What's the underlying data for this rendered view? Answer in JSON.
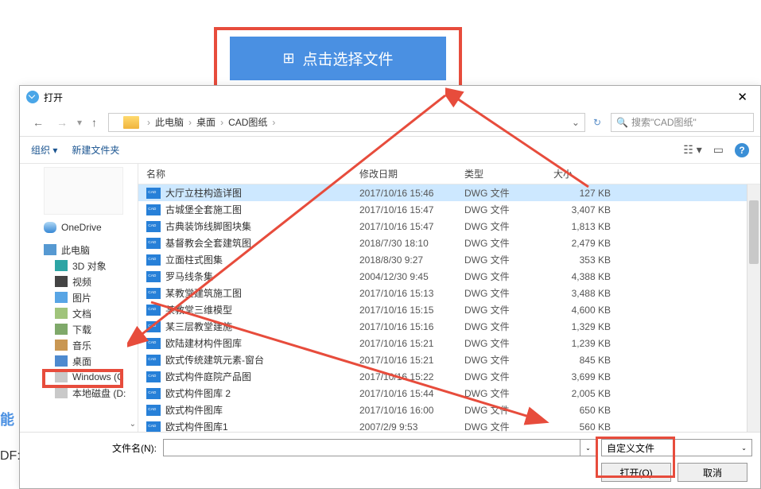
{
  "upload_button": "点击选择文件",
  "dialog": {
    "title": "打开",
    "breadcrumb": [
      "此电脑",
      "桌面",
      "CAD图纸"
    ],
    "search_placeholder": "搜索\"CAD图纸\"",
    "toolbar": {
      "organize": "组织 ▾",
      "new_folder": "新建文件夹"
    }
  },
  "sidebar": {
    "items": [
      {
        "label": "OneDrive",
        "icon": "cloud"
      },
      {
        "label": "此电脑",
        "icon": "pc"
      },
      {
        "label": "3D 对象",
        "icon": "3d"
      },
      {
        "label": "视频",
        "icon": "video"
      },
      {
        "label": "图片",
        "icon": "pic"
      },
      {
        "label": "文档",
        "icon": "doc"
      },
      {
        "label": "下载",
        "icon": "dl"
      },
      {
        "label": "音乐",
        "icon": "music"
      },
      {
        "label": "桌面",
        "icon": "desktop"
      },
      {
        "label": "Windows (C",
        "icon": "win"
      },
      {
        "label": "本地磁盘 (D:",
        "icon": "disk"
      }
    ]
  },
  "columns": {
    "name": "名称",
    "date": "修改日期",
    "type": "类型",
    "size": "大小"
  },
  "files": [
    {
      "name": "大厅立柱构造详图",
      "date": "2017/10/16 15:46",
      "type": "DWG 文件",
      "size": "127 KB",
      "selected": true
    },
    {
      "name": "古城堡全套施工图",
      "date": "2017/10/16 15:47",
      "type": "DWG 文件",
      "size": "3,407 KB"
    },
    {
      "name": "古典装饰线脚图块集",
      "date": "2017/10/16 15:47",
      "type": "DWG 文件",
      "size": "1,813 KB"
    },
    {
      "name": "基督教会全套建筑图",
      "date": "2018/7/30 18:10",
      "type": "DWG 文件",
      "size": "2,479 KB"
    },
    {
      "name": "立面柱式图集",
      "date": "2018/8/30 9:27",
      "type": "DWG 文件",
      "size": "353 KB"
    },
    {
      "name": "罗马线条集",
      "date": "2004/12/30 9:45",
      "type": "DWG 文件",
      "size": "4,388 KB"
    },
    {
      "name": "某教堂建筑施工图",
      "date": "2017/10/16 15:13",
      "type": "DWG 文件",
      "size": "3,488 KB"
    },
    {
      "name": "某教堂三维模型",
      "date": "2017/10/16 15:15",
      "type": "DWG 文件",
      "size": "4,600 KB"
    },
    {
      "name": "某三层教堂建施",
      "date": "2017/10/16 15:16",
      "type": "DWG 文件",
      "size": "1,329 KB"
    },
    {
      "name": "欧陆建材构件图库",
      "date": "2017/10/16 15:21",
      "type": "DWG 文件",
      "size": "1,239 KB"
    },
    {
      "name": "欧式传统建筑元素-窗台",
      "date": "2017/10/16 15:21",
      "type": "DWG 文件",
      "size": "845 KB"
    },
    {
      "name": "欧式构件庭院产品图",
      "date": "2017/10/16 15:22",
      "type": "DWG 文件",
      "size": "3,699 KB"
    },
    {
      "name": "欧式构件图库 2",
      "date": "2017/10/16 15:44",
      "type": "DWG 文件",
      "size": "2,005 KB"
    },
    {
      "name": "欧式构件图库",
      "date": "2017/10/16 16:00",
      "type": "DWG 文件",
      "size": "650 KB"
    },
    {
      "name": "欧式构件图库1",
      "date": "2007/2/9 9:53",
      "type": "DWG 文件",
      "size": "560 KB"
    }
  ],
  "bottom": {
    "filename_label": "文件名(N):",
    "filter": "自定义文件",
    "open": "打开(O)",
    "cancel": "取消"
  },
  "edge_text1": "能",
  "edge_text2": "DF:"
}
